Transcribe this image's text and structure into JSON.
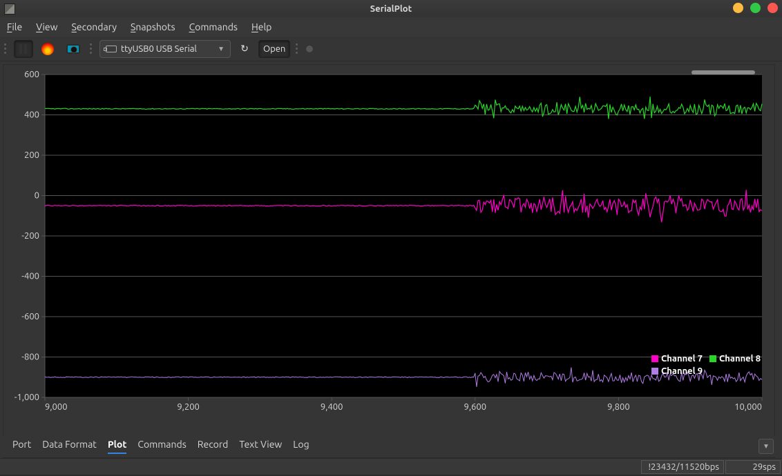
{
  "window": {
    "title": "SerialPlot"
  },
  "menu": {
    "items": [
      "File",
      "View",
      "Secondary",
      "Snapshots",
      "Commands",
      "Help"
    ]
  },
  "toolbar": {
    "port_selected": "ttyUSB0 USB Serial",
    "open_label": "Open"
  },
  "tabs": {
    "items": [
      "Port",
      "Data Format",
      "Plot",
      "Commands",
      "Record",
      "Text View",
      "Log"
    ],
    "active": "Plot"
  },
  "status": {
    "bps": "!23432/11520bps",
    "sps": "29sps"
  },
  "legend": [
    {
      "name": "Channel 7",
      "color": "#ff00c8"
    },
    {
      "name": "Channel 8",
      "color": "#28d628"
    },
    {
      "name": "Channel 9",
      "color": "#b17de6"
    }
  ],
  "chart_data": {
    "type": "line",
    "xlabel": "",
    "ylabel": "",
    "xlim": [
      9000,
      10000
    ],
    "ylim": [
      -1000,
      600
    ],
    "xticks": [
      9000,
      9200,
      9400,
      9600,
      9800,
      10000
    ],
    "yticks": [
      -1000,
      -800,
      -600,
      -400,
      -200,
      0,
      200,
      400,
      600
    ],
    "noise_start_x": 9600,
    "series": [
      {
        "name": "Channel 8",
        "color": "#28d628",
        "baseline": 430,
        "noise_amp": 35
      },
      {
        "name": "Channel 7",
        "color": "#ff00c8",
        "baseline": -50,
        "noise_amp": 45
      },
      {
        "name": "Channel 9",
        "color": "#b17de6",
        "baseline": -900,
        "noise_amp": 30
      }
    ]
  }
}
